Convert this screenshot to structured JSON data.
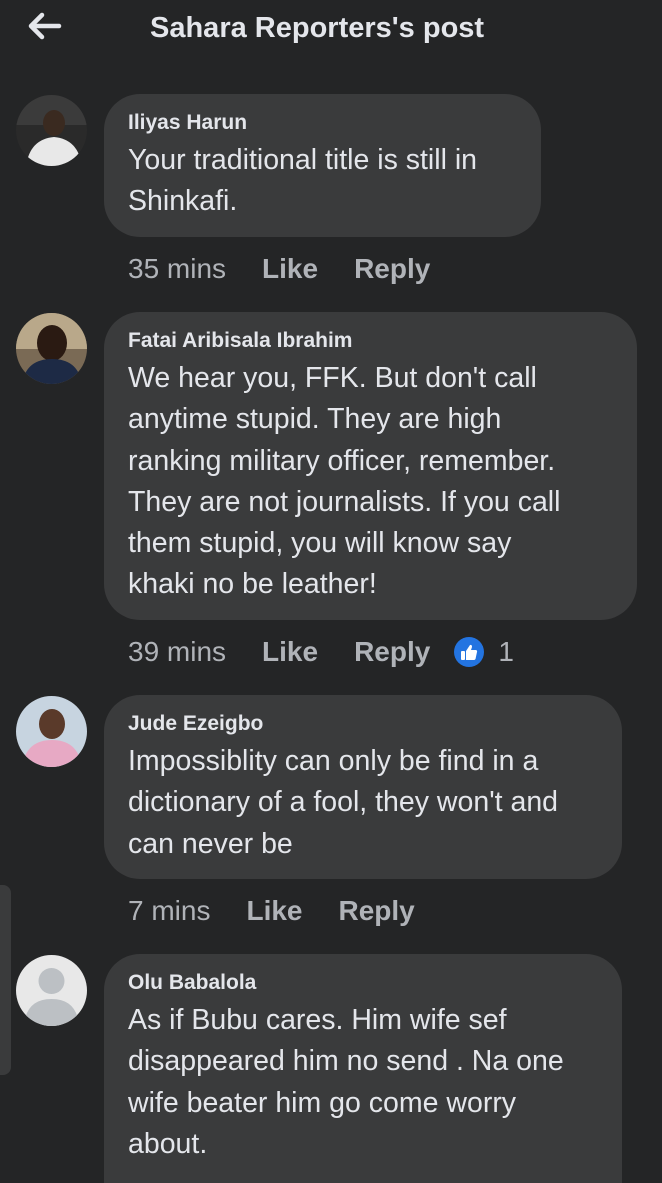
{
  "header": {
    "title": "Sahara Reporters's post",
    "back_icon": "arrow-left-icon"
  },
  "comments": [
    {
      "author": "Iliyas Harun",
      "text": "Your traditional title is still in\nShinkafi.",
      "time": "35 mins",
      "like_label": "Like",
      "reply_label": "Reply"
    },
    {
      "author": "Fatai Aribisala Ibrahim",
      "text": "We hear you, FFK. But don't call\nanytime stupid. They are high\nranking  military officer, remember.\nThey are not journalists. If you call\nthem stupid, you will know say\nkhaki no be leather!",
      "time": "39 mins",
      "like_label": "Like",
      "reply_label": "Reply",
      "reaction_count": "1",
      "reaction_icon": "thumbs-up-icon"
    },
    {
      "author": "Jude Ezeigbo",
      "text": "Impossiblity can only be find in a\ndictionary of a fool, they won't and\ncan never be",
      "time": "7 mins",
      "like_label": "Like",
      "reply_label": "Reply"
    },
    {
      "author": "Olu Babalola",
      "text": "As if Bubu cares. Him wife sef\ndisappeared him no send . Na one\nwife beater him go come worry\nabout."
    }
  ],
  "colors": {
    "background": "#242526",
    "bubble": "#3a3b3c",
    "primary_text": "#e4e6eb",
    "secondary_text": "#b0b3b8",
    "like_blue": "#2374e1"
  }
}
